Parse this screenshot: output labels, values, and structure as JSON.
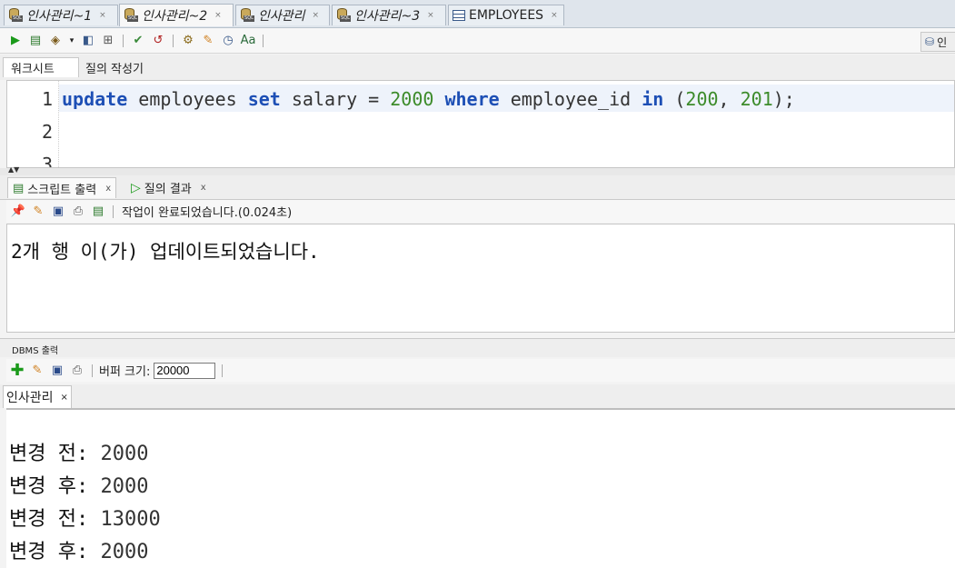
{
  "doc_tabs": [
    {
      "label": "인사관리~1"
    },
    {
      "label": "인사관리~2"
    },
    {
      "label": "인사관리"
    },
    {
      "label": "인사관리~3"
    },
    {
      "label": "EMPLOYEES"
    }
  ],
  "toolbar_right_label": "인",
  "worksheet_tabs": [
    "워크시트",
    "질의 작성기"
  ],
  "editor": {
    "line_numbers": [
      "1",
      "2",
      "3"
    ],
    "code": {
      "kw_update": "update",
      "t_employees": " employees ",
      "kw_set": "set",
      "t_salary": " salary = ",
      "n_2000": "2000",
      "t_sp": " ",
      "kw_where": "where",
      "t_empid": " employee_id ",
      "kw_in": "in",
      "t_paren": " (",
      "n_200": "200",
      "t_comma": ", ",
      "n_201": "201",
      "t_end": ");"
    }
  },
  "output_tabs": [
    {
      "label": "스크립트 출력",
      "close": "x"
    },
    {
      "label": "질의 결과",
      "close": "x"
    }
  ],
  "status_text": "작업이 완료되었습니다.(0.024초)",
  "script_output": "2개 행 이(가) 업데이트되었습니다.",
  "dbms": {
    "title": "DBMS 출력",
    "buffer_label": "버퍼 크기:",
    "buffer_value": "20000",
    "connection_tab": "인사관리",
    "connection_close": "×",
    "lines": [
      {
        "label": "변경 전:",
        "value": "2000"
      },
      {
        "label": "변경 후:",
        "value": "2000"
      },
      {
        "label": "변경 전:",
        "value": "13000"
      },
      {
        "label": "변경 후:",
        "value": "2000"
      }
    ]
  },
  "colors": {
    "keyword": "#1d4fb5",
    "number": "#3c8b2a"
  },
  "icons": [
    "sql-worksheet-icon",
    "table-icon",
    "run-icon",
    "run-script-icon",
    "commit-icon",
    "rollback-icon",
    "clear-icon",
    "pin-icon",
    "save-icon",
    "print-icon",
    "add-icon"
  ]
}
